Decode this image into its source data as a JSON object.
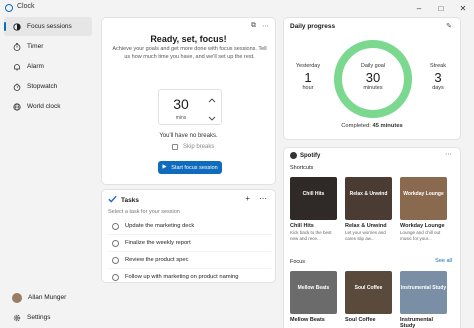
{
  "app": {
    "title": "Clock"
  },
  "sidebar": {
    "items": [
      {
        "label": "Focus sessions",
        "icon": "focus-icon",
        "active": true
      },
      {
        "label": "Timer",
        "icon": "timer-icon"
      },
      {
        "label": "Alarm",
        "icon": "alarm-icon"
      },
      {
        "label": "Stopwatch",
        "icon": "stopwatch-icon"
      },
      {
        "label": "World clock",
        "icon": "world-clock-icon"
      }
    ],
    "user": "Allan Munger",
    "settings": "Settings"
  },
  "focus": {
    "title": "Ready, set, focus!",
    "description": "Achieve your goals and get more done with focus sessions. Tell us how much time you have, and we'll set up the rest.",
    "minutes_value": "30",
    "minutes_unit": "mins",
    "break_text": "You'll have no breaks.",
    "skip_breaks": "Skip breaks",
    "start_button": "Start focus session"
  },
  "tasks": {
    "title": "Tasks",
    "placeholder": "Select a task for your session",
    "items": [
      "Update the marketing deck",
      "Finalize the weekly report",
      "Review the product spec",
      "Follow up with marketing on product naming"
    ]
  },
  "progress": {
    "title": "Daily progress",
    "yesterday": {
      "label": "Yesterday",
      "value": "1",
      "unit": "hour"
    },
    "goal": {
      "label": "Daily goal",
      "value": "30",
      "unit": "minutes"
    },
    "streak": {
      "label": "Streak",
      "value": "3",
      "unit": "days"
    },
    "completed_label": "Completed:",
    "completed_value": "45 minutes",
    "ring_color": "#7bd88f",
    "ring_fraction": 1.0
  },
  "spotify": {
    "title": "Spotify",
    "shortcuts_label": "Shortcuts",
    "focus_label": "Focus",
    "see_all": "See all",
    "shortcuts": [
      {
        "name": "Chill Hits",
        "desc": "Kick back to the best new and rece...",
        "cover_text": "Chill Hits",
        "color": "#2f2a28"
      },
      {
        "name": "Relax & Unwind",
        "desc": "Let your worries and cares slip aw...",
        "cover_text": "Relax & Unwind",
        "color": "#4a3b33"
      },
      {
        "name": "Workday Lounge",
        "desc": "Lounge and chill out music for your...",
        "cover_text": "Workday Lounge",
        "color": "#8a6a4e"
      }
    ],
    "focus_items": [
      {
        "name": "Mellow Beats",
        "cover_text": "Mellow Beats",
        "color": "#6b6b6b"
      },
      {
        "name": "Soul Coffee",
        "cover_text": "Soul Coffee",
        "color": "#5a4a3c"
      },
      {
        "name": "Instrumental Study",
        "cover_text": "Instrumental Study",
        "color": "#7a8fa5"
      }
    ]
  }
}
